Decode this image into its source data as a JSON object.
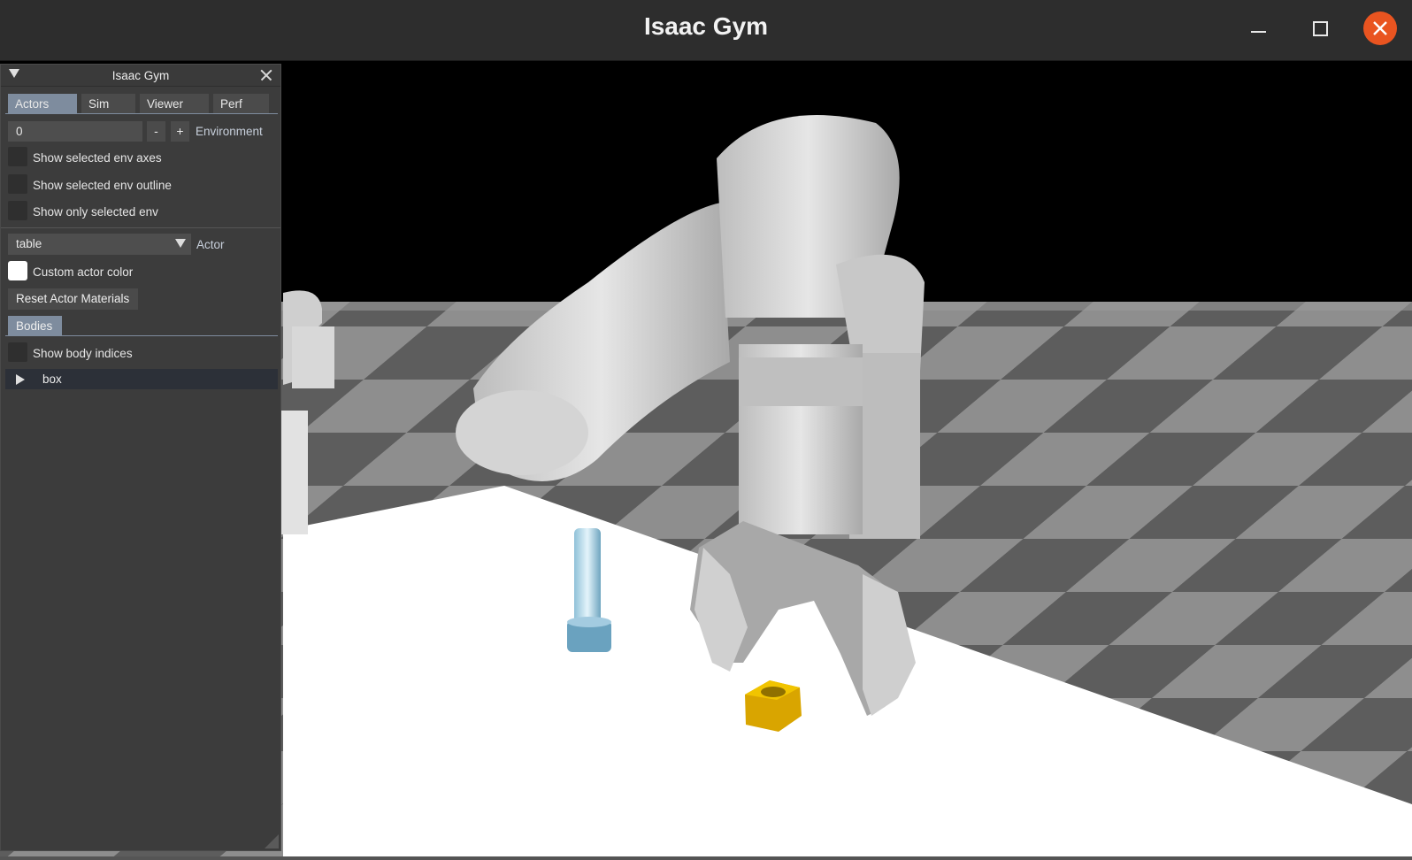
{
  "window": {
    "title": "Isaac Gym",
    "close_color": "#e95420"
  },
  "panel": {
    "title": "Isaac Gym",
    "tabs": [
      {
        "label": "Actors",
        "active": true
      },
      {
        "label": "Sim",
        "active": false
      },
      {
        "label": "Viewer",
        "active": false
      },
      {
        "label": "Perf",
        "active": false
      }
    ],
    "environment": {
      "value": "0",
      "minus_label": "-",
      "plus_label": "+",
      "label": "Environment"
    },
    "checkboxes": [
      {
        "label": "Show selected env axes",
        "checked": false
      },
      {
        "label": "Show selected env outline",
        "checked": false
      },
      {
        "label": "Show only selected env",
        "checked": false
      }
    ],
    "actor": {
      "selected": "table",
      "label": "Actor"
    },
    "custom_color": {
      "label": "Custom actor color",
      "swatch": "#ffffff"
    },
    "reset_button": "Reset Actor Materials",
    "bodies": {
      "tab_label": "Bodies",
      "show_indices": {
        "label": "Show body indices",
        "checked": false
      },
      "tree_items": [
        {
          "label": "box",
          "icon": "triangle-right-icon"
        }
      ]
    }
  },
  "scene": {
    "description_colors": {
      "sky": "#000000",
      "floor_light": "#8f8f8f",
      "floor_dark": "#5e5e5e",
      "table": "#ffffff",
      "robot": "#c9c9c9",
      "bolt": "#a9d3e6",
      "nut": "#e8b800"
    }
  }
}
